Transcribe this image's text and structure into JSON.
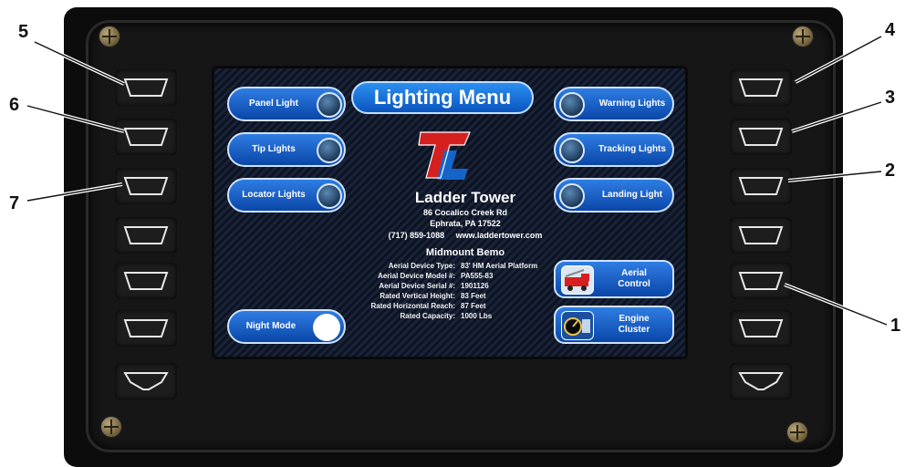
{
  "screen": {
    "title": "Lighting Menu",
    "left_buttons": [
      {
        "label": "Panel Light"
      },
      {
        "label": "Tip Lights"
      },
      {
        "label": "Locator Lights"
      }
    ],
    "right_buttons": [
      {
        "label": "Warning Lights"
      },
      {
        "label": "Tracking Lights"
      },
      {
        "label": "Landing Light"
      }
    ],
    "night_mode_label": "Night Mode",
    "aerial_control_label": "Aerial Control",
    "engine_cluster_label": "Engine Cluster",
    "company": {
      "name": "Ladder Tower",
      "address1": "86 Cocalico Creek Rd",
      "address2": "Ephrata, PA 17522",
      "phone": "(717) 859-1088",
      "website": "www.laddertower.com"
    },
    "specs": {
      "heading": "Midmount Bemo",
      "rows": [
        {
          "key": "Aerial Device Type:",
          "value": "83' HM Aerial Platform"
        },
        {
          "key": "Aerial Device Model #:",
          "value": "PA555-83"
        },
        {
          "key": "Aerial Device Serial #:",
          "value": "1901126"
        },
        {
          "key": "Rated Vertical Height:",
          "value": "83 Feet"
        },
        {
          "key": "Rated Horizontal Reach:",
          "value": "87 Feet"
        },
        {
          "key": "Rated Capacity:",
          "value": "1000 Lbs"
        }
      ]
    }
  },
  "callouts": [
    "1",
    "2",
    "3",
    "4",
    "5",
    "6",
    "7"
  ],
  "colors": {
    "button_blue": "#0a46a8",
    "button_border": "#cfe3ff",
    "logo_red": "#d62020",
    "logo_blue": "#1565c8"
  }
}
